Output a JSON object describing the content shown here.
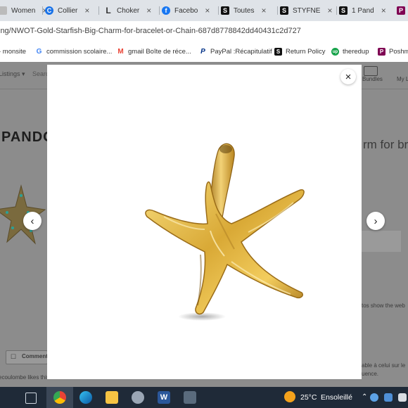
{
  "tabs": [
    {
      "label": "Women",
      "icon": "page-icon",
      "color": "#888888"
    },
    {
      "label": "Collier",
      "icon": "c-icon",
      "color": "#1a73e8"
    },
    {
      "label": "Choker",
      "icon": "l-icon",
      "color": "#333333"
    },
    {
      "label": "Facebo",
      "icon": "facebook-icon",
      "color": "#1877f2"
    },
    {
      "label": "Toutes",
      "icon": "s-icon",
      "color": "#111111"
    },
    {
      "label": "STYFNE",
      "icon": "s-icon",
      "color": "#111111"
    },
    {
      "label": "1 Pand",
      "icon": "s-icon",
      "color": "#111111"
    },
    {
      "label": "",
      "icon": "poshmark-icon",
      "color": "#7f0353"
    }
  ],
  "tab_close": "×",
  "url": "ing/NWOT-Gold-Starfish-Big-Charm-for-bracelet-or-Chain-687d8778842dd40431c2d727",
  "bookmarks": [
    {
      "label": "- monsite",
      "icon": "none",
      "color": "#ffffff"
    },
    {
      "label": "commission scolaire...",
      "icon": "google-icon",
      "color": "#4285f4",
      "glyph": "G"
    },
    {
      "label": "gmail Boîte de réce...",
      "icon": "gmail-icon",
      "color": "#ea4335",
      "glyph": "M"
    },
    {
      "label": "PayPal :Récapitulatif",
      "icon": "paypal-icon",
      "color": "#003087",
      "glyph": "P"
    },
    {
      "label": "Return Policy",
      "icon": "s-icon",
      "color": "#111111",
      "glyph": "S"
    },
    {
      "label": "theredup",
      "icon": "up-icon",
      "color": "#16a34a",
      "glyph": "up"
    },
    {
      "label": "Poshm",
      "icon": "poshmark-icon",
      "color": "#7f0353",
      "glyph": "P"
    }
  ],
  "background_page": {
    "listings": "Listings ▾",
    "search": "Search",
    "bundles": "Bundles",
    "my": "My L",
    "brand": "PANDO",
    "title_fragment": "rm for br",
    "photos_note": "tos show the web",
    "comment_button": "Comment",
    "likes": "ecoulombe likes this",
    "french_note_1": "able à celui sur le",
    "french_note_2": "uence."
  },
  "modal": {
    "close_label": "×",
    "prev_label": "‹",
    "next_label": "›"
  },
  "taskbar": {
    "temperature": "25°C",
    "weather": "Ensoleillé"
  }
}
